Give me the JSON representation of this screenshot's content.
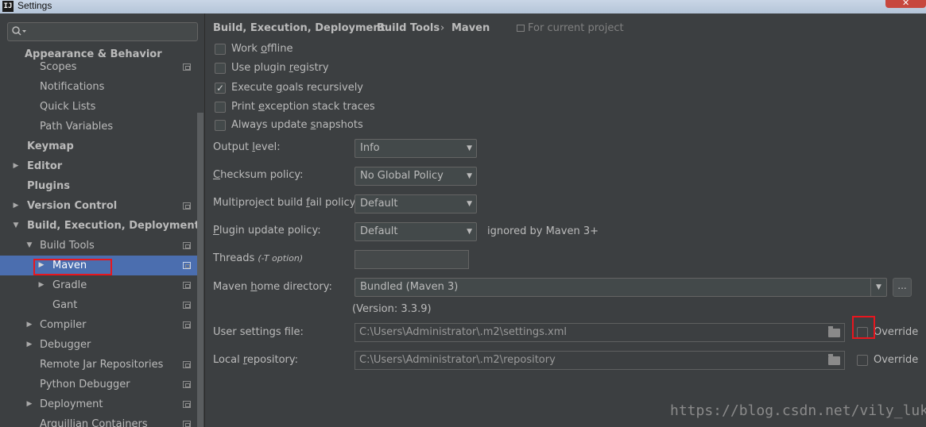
{
  "window": {
    "title": "Settings",
    "app_icon": "intellij-icon"
  },
  "search": {
    "placeholder": "",
    "icon": "search-icon"
  },
  "sidebar": {
    "items": [
      {
        "label": "Appearance & Behavior",
        "bold": true
      },
      {
        "label": "Scopes"
      },
      {
        "label": "Notifications"
      },
      {
        "label": "Quick Lists"
      },
      {
        "label": "Path Variables"
      },
      {
        "label": "Keymap",
        "bold": true
      },
      {
        "label": "Editor",
        "bold": true
      },
      {
        "label": "Plugins",
        "bold": true
      },
      {
        "label": "Version Control",
        "bold": true
      },
      {
        "label": "Build, Execution, Deployment",
        "bold": true
      },
      {
        "label": "Build Tools"
      },
      {
        "label": "Maven",
        "selected": true
      },
      {
        "label": "Gradle"
      },
      {
        "label": "Gant"
      },
      {
        "label": "Compiler"
      },
      {
        "label": "Debugger"
      },
      {
        "label": "Remote Jar Repositories"
      },
      {
        "label": "Python Debugger"
      },
      {
        "label": "Deployment"
      },
      {
        "label": "Arquillian Containers"
      }
    ]
  },
  "breadcrumb": {
    "items": [
      "Build, Execution, Deployment",
      "Build Tools",
      "Maven"
    ],
    "separator": "›",
    "scope": "For current project"
  },
  "checkboxes": {
    "work_offline": {
      "pre": "Work ",
      "u": "o",
      "post": "ffline",
      "checked": false
    },
    "use_plugin_registry": {
      "pre": "Use plugin ",
      "u": "r",
      "post": "egistry",
      "checked": false
    },
    "execute_goals": {
      "pre": "Execute ",
      "u": "g",
      "post": "oals recursively",
      "checked": true
    },
    "print_exception": {
      "pre": "Print ",
      "u": "e",
      "post": "xception stack traces",
      "checked": false
    },
    "always_update": {
      "pre": "Always update ",
      "u": "s",
      "post": "napshots",
      "checked": false
    }
  },
  "form": {
    "output_level": {
      "pre": "Output ",
      "u": "l",
      "post": "evel:",
      "value": "Info"
    },
    "checksum_policy": {
      "pre": "",
      "u": "C",
      "post": "hecksum policy:",
      "value": "No Global Policy"
    },
    "multiproject_fail": {
      "pre": "Multiproject build ",
      "u": "f",
      "post": "ail policy:",
      "value": "Default"
    },
    "plugin_update": {
      "pre": "",
      "u": "P",
      "post": "lugin update policy:",
      "value": "Default",
      "note": "ignored by Maven 3+"
    },
    "threads": {
      "label": "Threads",
      "hint": "(-T option)",
      "value": ""
    },
    "maven_home": {
      "pre": "Maven ",
      "u": "h",
      "post": "ome directory:",
      "value": "Bundled (Maven 3)",
      "browse": "...",
      "version": "(Version: 3.3.9)"
    },
    "user_settings": {
      "label": "User settings file:",
      "value": "C:\\Users\\Administrator\\.m2\\settings.xml",
      "override": "Override"
    },
    "local_repo": {
      "pre": "Local ",
      "u": "r",
      "post": "epository:",
      "value": "C:\\Users\\Administrator\\.m2\\repository",
      "override": "Override"
    }
  },
  "watermark": "https://blog.csdn.net/vily_luky",
  "colors": {
    "background": "#3c3f41",
    "selection": "#4b6eaf",
    "highlight": "#e8161e",
    "text": "#bbbbbb"
  }
}
